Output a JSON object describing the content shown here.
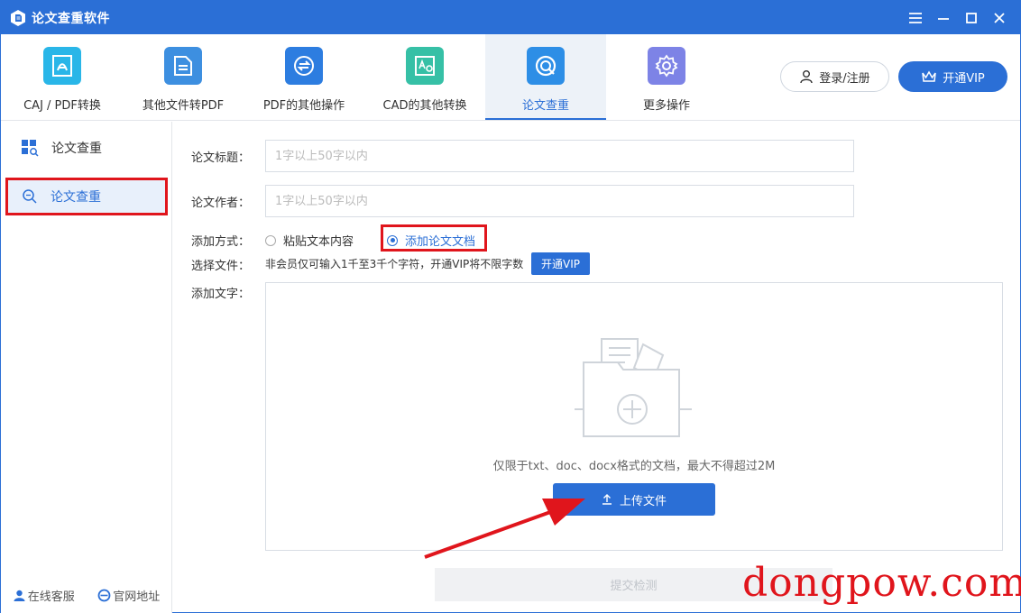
{
  "window": {
    "title": "论文查重软件"
  },
  "toolbar": {
    "tools": [
      {
        "label": "CAJ / PDF转换",
        "icon": "pdf-convert-icon",
        "color": "#29b6e8"
      },
      {
        "label": "其他文件转PDF",
        "icon": "file-to-pdf-icon",
        "color": "#3d8fe0"
      },
      {
        "label": "PDF的其他操作",
        "icon": "pdf-operations-icon",
        "color": "#2d7de0"
      },
      {
        "label": "CAD的其他转换",
        "icon": "cad-convert-icon",
        "color": "#36c0a6"
      },
      {
        "label": "论文查重",
        "icon": "plagiarism-check-icon",
        "color": "#2d8ee6",
        "active": true
      },
      {
        "label": "更多操作",
        "icon": "more-settings-icon",
        "color": "#7d83e6"
      }
    ],
    "login_label": "登录/注册",
    "vip_label": "开通VIP"
  },
  "sidebar": {
    "header": "论文查重",
    "items": [
      {
        "label": "论文查重",
        "active": true
      }
    ],
    "footer": {
      "service": "在线客服",
      "website": "官网地址"
    }
  },
  "form": {
    "title_label": "论文标题：",
    "title_placeholder": "1字以上50字以内",
    "title_value": "",
    "author_label": "论文作者：",
    "author_placeholder": "1字以上50字以内",
    "author_value": "",
    "method_label": "添加方式：",
    "method_options": [
      {
        "label": "粘贴文本内容",
        "selected": false
      },
      {
        "label": "添加论文文档",
        "selected": true
      }
    ],
    "file_label": "选择文件：",
    "file_hint": "非会员仅可输入1千至3千个字符，开通VIP将不限字数",
    "vip_small_label": "开通VIP",
    "text_label": "添加文字：",
    "dropzone_hint": "仅限于txt、doc、docx格式的文档，最大不得超过2M",
    "upload_label": "上传文件",
    "submit_label": "提交检测"
  },
  "watermark": "dongpow.com",
  "colors": {
    "accent": "#2b6fd6",
    "highlight": "#e0151c"
  }
}
